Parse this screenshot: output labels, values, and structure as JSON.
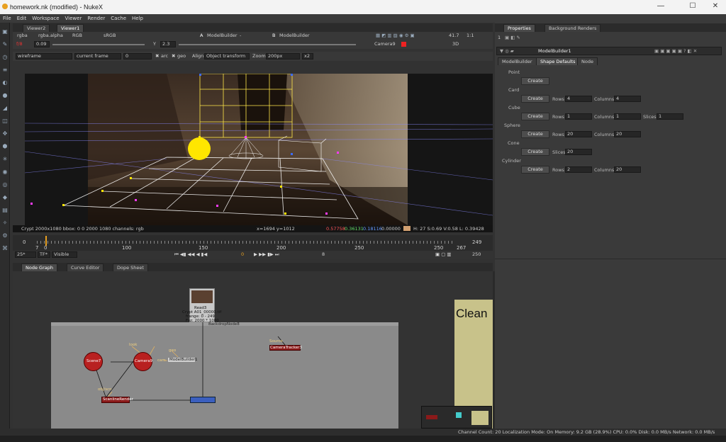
{
  "window": {
    "title": "homework.nk (modified) - NukeX",
    "minimize": "—",
    "maximize": "☐",
    "close": "✕"
  },
  "menu": [
    "File",
    "Edit",
    "Workspace",
    "Viewer",
    "Render",
    "Cache",
    "Help"
  ],
  "viewer_tabs": [
    "Viewer2",
    "Viewer1"
  ],
  "viewer_controls": {
    "channels": "rgba",
    "alpha": "rgba.alpha",
    "colorspace_mode": "RGB",
    "lut": "sRGB",
    "input_a_label": "A",
    "input_a": "ModelBuilder",
    "input_a_op": "-",
    "input_b_label": "B",
    "input_b": "ModelBuilder",
    "fstop_label": "f/8",
    "gain": "0.09",
    "gamma_label": "Y",
    "gamma": "2.3",
    "zoom_level": "41.7",
    "ratio": "1:1",
    "camera": "Camera9",
    "view_mode": "3D",
    "display": "wireframe",
    "frame_mode": "current frame",
    "frame_value": "0",
    "arc": "arc",
    "geo": "geo",
    "align_label": "Align",
    "align": "Object transform",
    "zoom_label": "Zoom",
    "zoom": "200px",
    "zoom_mult": "x2"
  },
  "info_bar": {
    "format": "Crypt 2000x1080  bbox: 0 0 2000 1080 channels: rgb",
    "coords": "x=1694 y=1012",
    "r": "0.57758",
    "g": "0.36131",
    "b": "0.18116",
    "a": "0.00000",
    "hsvl": "H: 27 S:0.69 V:0.58  L: 0.39428"
  },
  "timeline": {
    "ticks": [
      "0",
      "50",
      "100",
      "150",
      "200",
      "250"
    ],
    "start": "0",
    "in": "7",
    "in2": "0",
    "end": "249",
    "end2": "267",
    "last": "250",
    "fps": "25*",
    "tf": "TF*",
    "visibility": "Visible",
    "current_frame": "0",
    "step": "8"
  },
  "node_tabs": [
    "Node Graph",
    "Curve Editor",
    "Dope Sheet"
  ],
  "nodes": {
    "read": {
      "name": "Read3",
      "file": "Crypt A01_00000.tif",
      "range": "frange: 0 - 249",
      "size": "Fsz: 2000 * 1080"
    },
    "backdrop": "BackdropNode8",
    "scene": "Scene7",
    "camera": "Camera9",
    "modelbuilder": "ModelBuilder1",
    "scanline": "ScanlineRender",
    "camtracker": "CameraTracker3",
    "look_label": "look",
    "geo_label": "geo",
    "cam_label": "cam",
    "obj_label": "obj/scn",
    "source_label": "Source",
    "clean": "Clean"
  },
  "props_tabs": [
    "Properties",
    "Background Renders"
  ],
  "props_count": "1",
  "props_node": "ModelBuilder1",
  "props_subtabs": [
    "ModelBuilder",
    "Shape Defaults",
    "Node"
  ],
  "shapes": [
    {
      "name": "Point",
      "button": "Create",
      "params": []
    },
    {
      "name": "Card",
      "button": "Create",
      "params": [
        {
          "label": "Rows",
          "value": "4"
        },
        {
          "label": "Columns",
          "value": "4"
        }
      ]
    },
    {
      "name": "Cube",
      "button": "Create",
      "params": [
        {
          "label": "Rows",
          "value": "1"
        },
        {
          "label": "Columns",
          "value": "1"
        },
        {
          "label": "Slices",
          "value": "1"
        }
      ]
    },
    {
      "name": "Sphere",
      "button": "Create",
      "params": [
        {
          "label": "Rows",
          "value": "20"
        },
        {
          "label": "Columns",
          "value": "20"
        }
      ]
    },
    {
      "name": "Cone",
      "button": "Create",
      "params": [
        {
          "label": "Slices",
          "value": "20"
        }
      ]
    },
    {
      "name": "Cylinder",
      "button": "Create",
      "params": [
        {
          "label": "Rows",
          "value": "2"
        },
        {
          "label": "Columns",
          "value": "20"
        }
      ]
    }
  ],
  "status": "Channel Count: 20  Localization Mode: On  Memory: 9.2 GB (28.9%)  CPU: 0.0%  Disk: 0.0 MB/s  Network: 0.0 MB/s",
  "colors": {
    "accent": "#e8a020",
    "read_node": "#c8c8c8",
    "scene_node": "#b82020",
    "scanline_node": "#8b1a1a",
    "highlight_node": "#3b5fbf",
    "backdrop": "#8a8a8a",
    "clean_backdrop": "#c8c28a"
  }
}
